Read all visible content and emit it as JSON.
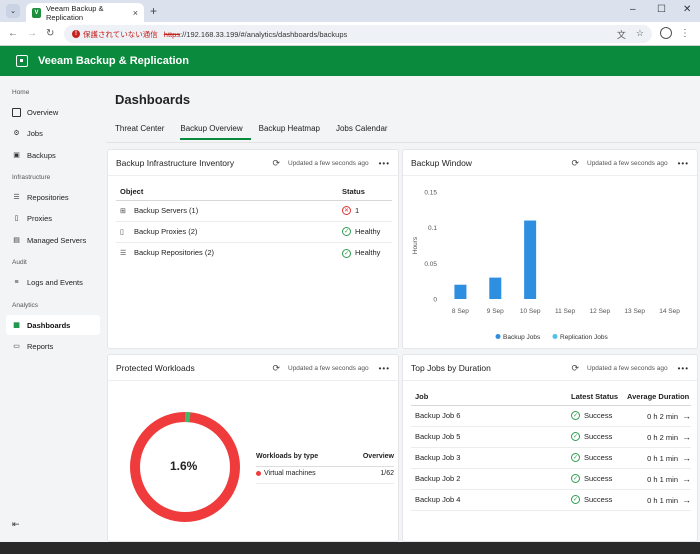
{
  "browser": {
    "tab_title": "Veeam Backup & Replication",
    "new_tab": "+",
    "security_warning": "保護されていない通信",
    "url_scheme": "https",
    "url_rest": "://192.168.33.199/#/analytics/dashboards/backups"
  },
  "app": {
    "title": "Veeam Backup & Replication"
  },
  "sidebar": {
    "sections": [
      {
        "label": "Home",
        "items": [
          {
            "label": "Overview"
          },
          {
            "label": "Jobs"
          },
          {
            "label": "Backups"
          }
        ]
      },
      {
        "label": "Infrastructure",
        "items": [
          {
            "label": "Repositories"
          },
          {
            "label": "Proxies"
          },
          {
            "label": "Managed Servers"
          }
        ]
      },
      {
        "label": "Audit",
        "items": [
          {
            "label": "Logs and Events"
          }
        ]
      },
      {
        "label": "Analytics",
        "items": [
          {
            "label": "Dashboards"
          },
          {
            "label": "Reports"
          }
        ]
      }
    ],
    "active": "Dashboards"
  },
  "page": {
    "title": "Dashboards",
    "tabs": [
      {
        "label": "Threat Center"
      },
      {
        "label": "Backup Overview"
      },
      {
        "label": "Backup Heatmap"
      },
      {
        "label": "Jobs Calendar"
      }
    ],
    "active_tab": "Backup Overview"
  },
  "cards": {
    "inventory": {
      "title": "Backup Infrastructure Inventory",
      "updated": "Updated a few seconds ago",
      "col_object": "Object",
      "col_status": "Status",
      "rows": [
        {
          "object": "Backup Servers (1)",
          "status": "1",
          "state": "error"
        },
        {
          "object": "Backup Proxies (2)",
          "status": "Healthy",
          "state": "ok"
        },
        {
          "object": "Backup Repositories (2)",
          "status": "Healthy",
          "state": "ok"
        }
      ]
    },
    "window": {
      "title": "Backup Window",
      "updated": "Updated a few seconds ago"
    },
    "workloads": {
      "title": "Protected Workloads",
      "updated": "Updated a few seconds ago",
      "percent": "1.6%",
      "col_type": "Workloads by type",
      "col_overview": "Overview",
      "row_type": "Virtual machines",
      "row_value": "1/62",
      "protected_fraction": 0.016
    },
    "topjobs": {
      "title": "Top Jobs by Duration",
      "updated": "Updated a few seconds ago",
      "col_job": "Job",
      "col_status": "Latest Status",
      "col_duration": "Average Duration",
      "rows": [
        {
          "job": "Backup Job 6",
          "status": "Success",
          "duration": "0 h 2 min"
        },
        {
          "job": "Backup Job 5",
          "status": "Success",
          "duration": "0 h 2 min"
        },
        {
          "job": "Backup Job 3",
          "status": "Success",
          "duration": "0 h 1 min"
        },
        {
          "job": "Backup Job 2",
          "status": "Success",
          "duration": "0 h 1 min"
        },
        {
          "job": "Backup Job 4",
          "status": "Success",
          "duration": "0 h 1 min"
        }
      ]
    }
  },
  "colors": {
    "accent": "#0a8a3c",
    "backup": "#2e8fe0",
    "replication": "#4fc0e8",
    "danger": "#ef3b3b",
    "protected": "#41b96b"
  },
  "chart_data": {
    "type": "bar",
    "categories": [
      "8 Sep",
      "9 Sep",
      "10 Sep",
      "11 Sep",
      "12 Sep",
      "13 Sep",
      "14 Sep"
    ],
    "series": [
      {
        "name": "Backup Jobs",
        "values": [
          0.02,
          0.03,
          0.11,
          0,
          0,
          0,
          0
        ]
      },
      {
        "name": "Replication Jobs",
        "values": [
          0,
          0,
          0,
          0,
          0,
          0,
          0
        ]
      }
    ],
    "ylabel": "Hours",
    "yticks": [
      "0",
      "0.05",
      "0.1",
      "0.15"
    ],
    "ylim": [
      0,
      0.15
    ],
    "grid": false,
    "legend": "bottom"
  }
}
